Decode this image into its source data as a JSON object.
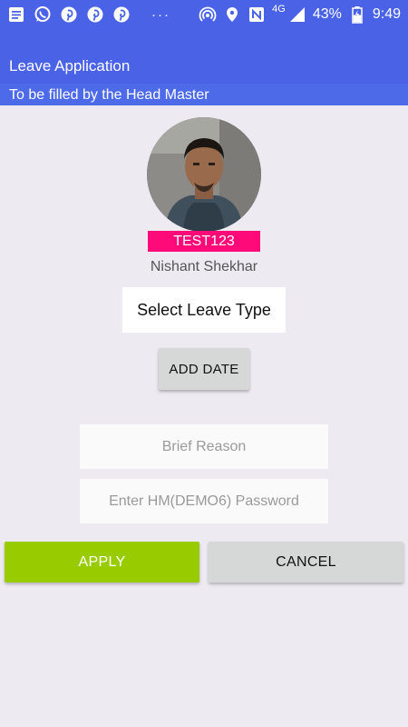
{
  "status_bar": {
    "network_type": "4G",
    "battery_percent": "43%",
    "time": "9:49",
    "overflow": "···",
    "left_icons": [
      "notes-icon",
      "whatsapp-icon",
      "pinterest-icon",
      "pinterest-icon",
      "pinterest-icon"
    ],
    "right_icons": [
      "hotspot-icon",
      "location-icon",
      "nfc-icon",
      "signal-icon",
      "battery-icon"
    ]
  },
  "header": {
    "title": "Leave Application",
    "subtitle": "To be filled by the Head Master"
  },
  "profile": {
    "employee_code": "TEST123",
    "name": "Nishant Shekhar"
  },
  "form": {
    "leave_type_label": "Select Leave Type",
    "add_date_label": "ADD DATE",
    "reason_placeholder": "Brief Reason",
    "password_placeholder": "Enter HM(DEMO6) Password"
  },
  "actions": {
    "apply_label": "APPLY",
    "cancel_label": "CANCEL"
  },
  "colors": {
    "header": "#4a63e6",
    "code_badge": "#ff0a78",
    "apply": "#99cc00",
    "neutral_button": "#d6d7d7",
    "background": "#edeaf1"
  }
}
